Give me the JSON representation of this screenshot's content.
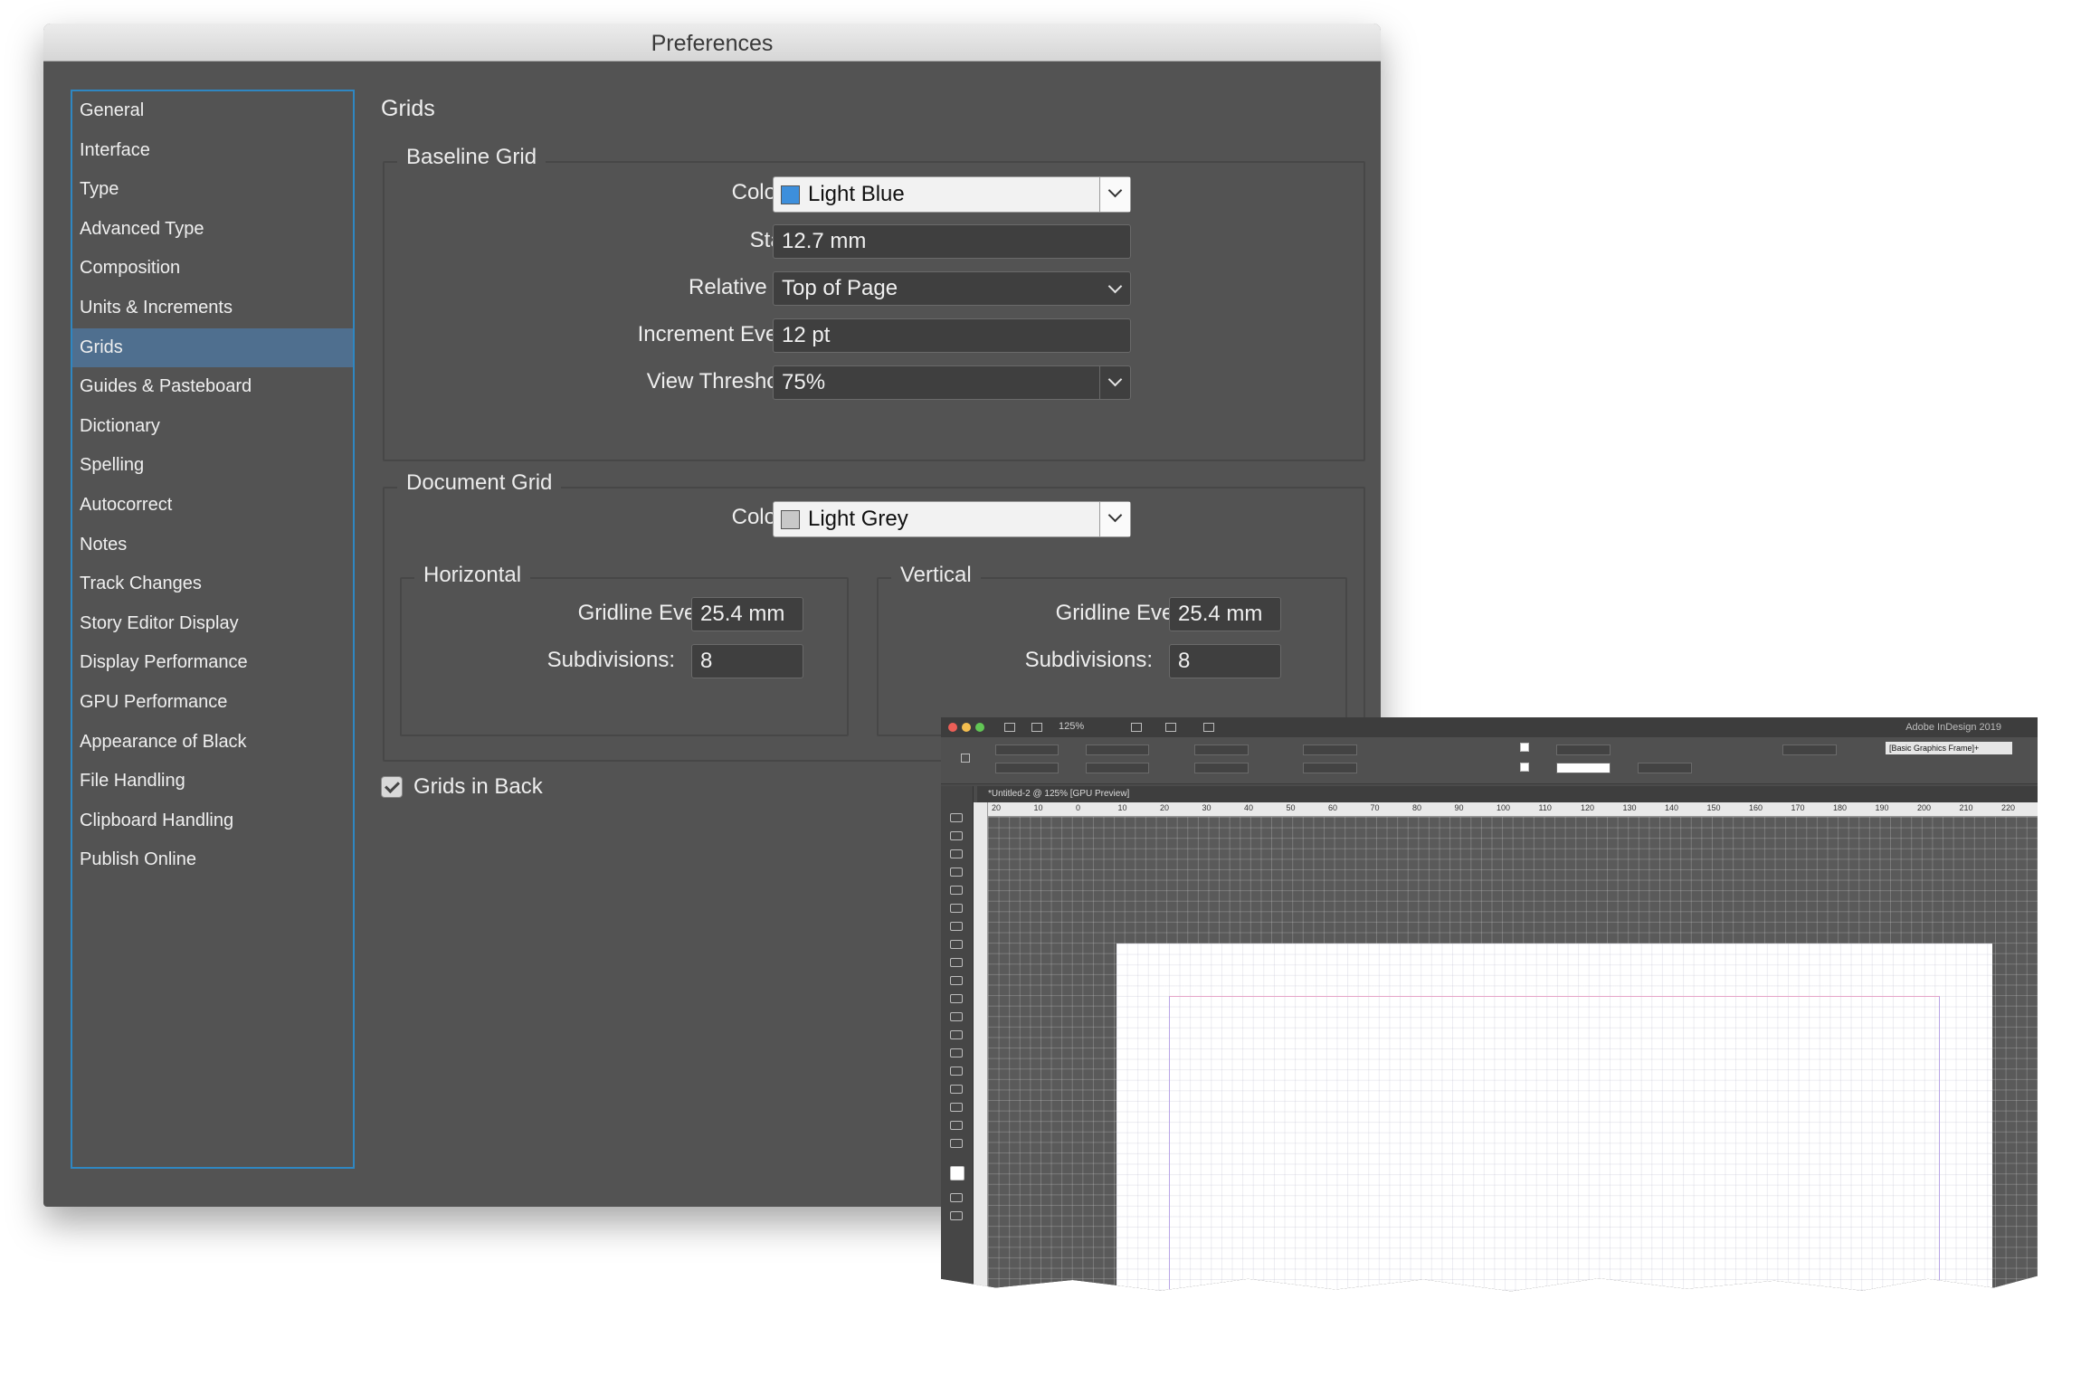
{
  "window": {
    "title": "Preferences"
  },
  "sidebar": {
    "items": [
      {
        "label": "General"
      },
      {
        "label": "Interface"
      },
      {
        "label": "Type"
      },
      {
        "label": "Advanced Type"
      },
      {
        "label": "Composition"
      },
      {
        "label": "Units & Increments"
      },
      {
        "label": "Grids",
        "selected": true
      },
      {
        "label": "Guides & Pasteboard"
      },
      {
        "label": "Dictionary"
      },
      {
        "label": "Spelling"
      },
      {
        "label": "Autocorrect"
      },
      {
        "label": "Notes"
      },
      {
        "label": "Track Changes"
      },
      {
        "label": "Story Editor Display"
      },
      {
        "label": "Display Performance"
      },
      {
        "label": "GPU Performance"
      },
      {
        "label": "Appearance of Black"
      },
      {
        "label": "File Handling"
      },
      {
        "label": "Clipboard Handling"
      },
      {
        "label": "Publish Online"
      }
    ]
  },
  "content": {
    "title": "Grids",
    "baseline_grid": {
      "title": "Baseline Grid",
      "colour_label": "Colour:",
      "colour_value": "Light Blue",
      "colour_swatch": "#3d8fdc",
      "start_label": "Start:",
      "start_value": "12.7 mm",
      "relative_label": "Relative To:",
      "relative_value": "Top of Page",
      "increment_label": "Increment Every:",
      "increment_value": "12 pt",
      "threshold_label": "View Threshold:",
      "threshold_value": "75%"
    },
    "document_grid": {
      "title": "Document Grid",
      "colour_label": "Colour:",
      "colour_value": "Light Grey",
      "colour_swatch": "#c8c8c8",
      "horizontal": {
        "title": "Horizontal",
        "gridline_label": "Gridline Every:",
        "gridline_value": "25.4 mm",
        "subdivisions_label": "Subdivisions:",
        "subdivisions_value": "8"
      },
      "vertical": {
        "title": "Vertical",
        "gridline_label": "Gridline Every:",
        "gridline_value": "25.4 mm",
        "subdivisions_label": "Subdivisions:",
        "subdivisions_value": "8"
      }
    },
    "grids_in_back": {
      "label": "Grids in Back",
      "checked": true
    }
  },
  "indesign": {
    "app_title": "Adobe InDesign 2019",
    "zoom": "125%",
    "doc_tab": "*Untitled-2 @ 125% [GPU Preview]",
    "frame_style": "[Basic Graphics Frame]+",
    "ruler_ticks": [
      "20",
      "10",
      "0",
      "10",
      "20",
      "30",
      "40",
      "50",
      "60",
      "70",
      "80",
      "90",
      "100",
      "110",
      "120",
      "130",
      "140",
      "150",
      "160",
      "170",
      "180",
      "190",
      "200",
      "210",
      "220"
    ]
  },
  "colors": {
    "accent": "#2f87c2",
    "selection": "#4f6f8f",
    "panel": "#535353"
  }
}
